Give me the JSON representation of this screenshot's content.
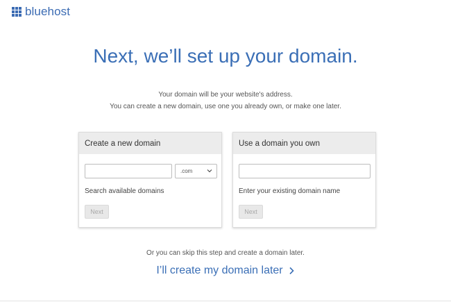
{
  "header": {
    "logo_text": "bluehost",
    "brand_color": "#3b6bb3"
  },
  "main": {
    "heading": "Next, we’ll set up your domain.",
    "subtitle_line1": "Your domain will be your website's address.",
    "subtitle_line2": "You can create a new domain, use one you already own, or make one later."
  },
  "new_domain_card": {
    "title": "Create a new domain",
    "domain_input": {
      "value": "",
      "placeholder": ""
    },
    "tld_select": {
      "selected": ".com"
    },
    "hint": "Search available domains",
    "next_label": "Next"
  },
  "existing_domain_card": {
    "title": "Use a domain you own",
    "domain_input": {
      "value": "",
      "placeholder": ""
    },
    "hint": "Enter your existing domain name",
    "next_label": "Next"
  },
  "footer": {
    "skip_text": "Or you can skip this step and create a domain later.",
    "later_link": "I’ll create my domain later",
    "link_color": "#3b6fb6"
  },
  "icons": [
    "bluehost-grid-logo-icon",
    "chevron-down-icon",
    "chevron-right-icon"
  ]
}
